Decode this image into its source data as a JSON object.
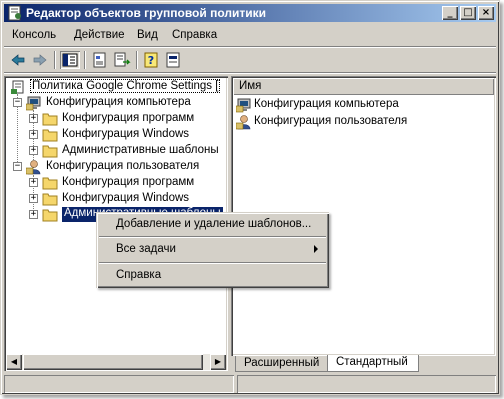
{
  "window": {
    "title": "Редактор объектов групповой политики",
    "minimize_glyph": "_",
    "maximize_glyph": "□",
    "close_glyph": "×"
  },
  "menu": [
    "Консоль",
    "Действие",
    "Вид",
    "Справка"
  ],
  "toolbar": {
    "icons": [
      "back-arrow-icon",
      "forward-arrow-icon",
      "show-hide-tree-icon",
      "properties-icon",
      "export-list-icon",
      "help-icon",
      "help-topics-icon"
    ]
  },
  "tree": {
    "root": "Политика Google Chrome Settings [",
    "computer_config": {
      "label": "Конфигурация компьютера",
      "children": [
        "Конфигурация программ",
        "Конфигурация Windows",
        "Административные шаблоны"
      ]
    },
    "user_config": {
      "label": "Конфигурация пользователя",
      "children": [
        "Конфигурация программ",
        "Конфигурация Windows",
        "Административные шаблоны"
      ]
    }
  },
  "list": {
    "column_header": "Имя",
    "items": [
      "Конфигурация компьютера",
      "Конфигурация пользователя"
    ]
  },
  "tabs": {
    "extended": "Расширенный",
    "standard": "Стандартный"
  },
  "context_menu": {
    "add_remove_templates": "Добавление и удаление шаблонов...",
    "all_tasks": "Все задачи",
    "help": "Справка"
  },
  "colors": {
    "title_start": "#0a246a",
    "title_end": "#a6caf0",
    "selection": "#0a246a",
    "face": "#d4d0c8",
    "folder": "#f5d66b"
  }
}
